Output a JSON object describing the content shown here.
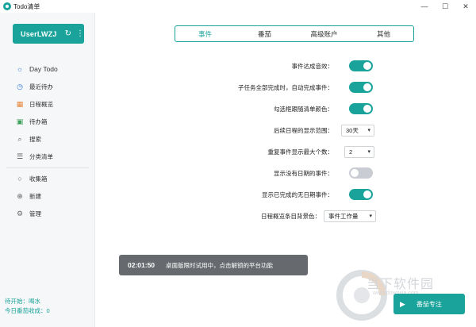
{
  "window": {
    "title": "Todo清单",
    "minimize": "—",
    "maximize": "☐",
    "close": "✕"
  },
  "sidebar": {
    "user": {
      "name": "UserLWZJ",
      "sync_icon": "↻",
      "more_icon": "⋮"
    },
    "items": [
      {
        "label": "Day Todo",
        "icon": "sun-icon",
        "glyph": "☼"
      },
      {
        "label": "最近待办",
        "icon": "clock-icon",
        "glyph": "◷"
      },
      {
        "label": "日程概览",
        "icon": "calendar-icon",
        "glyph": "▦"
      },
      {
        "label": "待办箱",
        "icon": "inbox-icon",
        "glyph": "▣"
      },
      {
        "label": "搜索",
        "icon": "search-icon",
        "glyph": "⌕"
      },
      {
        "label": "分类清单",
        "icon": "list-icon",
        "glyph": "☰"
      },
      {
        "label": "收集箱",
        "icon": "circle-icon",
        "glyph": "○"
      },
      {
        "label": "新建",
        "icon": "add-circle-icon",
        "glyph": "⊕"
      },
      {
        "label": "管理",
        "icon": "gear-icon",
        "glyph": "⚙"
      }
    ],
    "footer": {
      "line1": "待开始：喝水",
      "line2": "今日番茄收成：0"
    }
  },
  "tabs": [
    {
      "label": "事件",
      "active": true
    },
    {
      "label": "番茄",
      "active": false
    },
    {
      "label": "高级账户",
      "active": false
    },
    {
      "label": "其他",
      "active": false
    }
  ],
  "settings": {
    "r1": {
      "label": "事件达成音效：",
      "on": true
    },
    "r2": {
      "label": "子任务全部完成时，自动完成事件：",
      "on": true
    },
    "r3": {
      "label": "勾选框跟随清单颜色：",
      "on": true
    },
    "r4": {
      "label": "后续日程的显示范围：",
      "value": "30天"
    },
    "r5": {
      "label": "重复事件显示最大个数：",
      "value": "2"
    },
    "r6": {
      "label": "显示没有日期的事件：",
      "on": false
    },
    "r7": {
      "label": "显示已完成的无日期事件：",
      "on": true
    },
    "r8": {
      "label": "日程概览条目背景色：",
      "value": "事件工作量"
    },
    "caret": "▾"
  },
  "toast": {
    "time": "02:01:50",
    "message": "桌面版限时试用中，点击解锁的平台功能"
  },
  "focus_button": {
    "play": "▶",
    "label": "番茄专注"
  },
  "watermark": {
    "text": "当下软件园",
    "url": "www.downxia.com"
  },
  "colors": {
    "accent": "#1aa39a",
    "toggle_off": "#c9ccd2"
  }
}
